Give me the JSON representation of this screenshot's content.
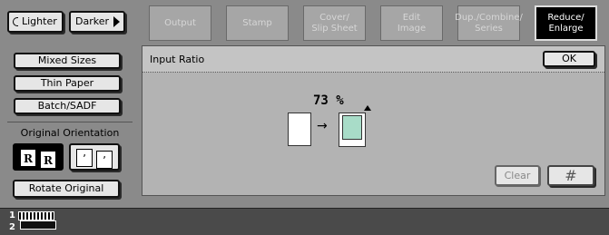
{
  "density": {
    "lighter_label": "Lighter",
    "darker_label": "Darker"
  },
  "tabs": [
    {
      "label": "Output",
      "active": false
    },
    {
      "label": "Stamp",
      "active": false
    },
    {
      "label": "Cover/\nSlip Sheet",
      "active": false
    },
    {
      "label": "Edit\nImage",
      "active": false
    },
    {
      "label": "Dup./Combine/\nSeries",
      "active": false
    },
    {
      "label": "Reduce/\nEnlarge",
      "active": true
    }
  ],
  "left_menu": {
    "mixed_sizes": "Mixed Sizes",
    "thin_paper": "Thin Paper",
    "batch_sadf": "Batch/SADF",
    "orientation_title": "Original Orientation",
    "orientation_a_glyph": "R",
    "orientation_b_glyph": "ʼ",
    "rotate_original": "Rotate Original"
  },
  "panel": {
    "title": "Input Ratio",
    "ok_label": "OK",
    "ratio_value": "73",
    "ratio_unit": "%",
    "arrow": "→",
    "clear_label": "Clear",
    "hash_label": "#"
  },
  "status": {
    "line1": "1",
    "line2": "2"
  },
  "colors": {
    "background": "#8a8a8a",
    "panel": "#b3b3b3",
    "active_tab": "#000000",
    "reduced_page": "#a8dcc8"
  },
  "icons": {
    "lighter": "half-circle-left-icon",
    "darker": "triangle-right-icon",
    "original_stack": "document-stack-icon"
  }
}
